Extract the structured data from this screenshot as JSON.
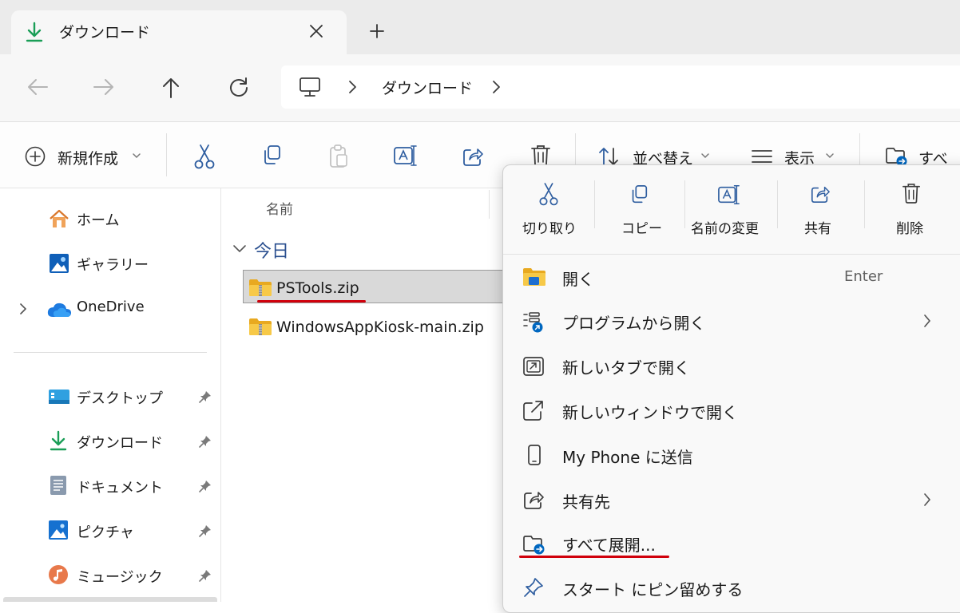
{
  "tab": {
    "title": "ダウンロード",
    "close": "×",
    "new_tab": "+"
  },
  "breadcrumb": {
    "current": "ダウンロード",
    "separator": ">"
  },
  "commandbar": {
    "new": "新規作成",
    "sort": "並べ替え",
    "view": "表示",
    "extract_all": "すべて"
  },
  "navpane": {
    "items": [
      "ホーム",
      "ギャラリー",
      "OneDrive"
    ],
    "pinned": [
      "デスクトップ",
      "ダウンロード",
      "ドキュメント",
      "ピクチャ",
      "ミュージック"
    ]
  },
  "filelist": {
    "column_name": "名前",
    "group": "今日",
    "files": [
      "PSTools.zip",
      "WindowsAppKiosk-main.zip"
    ]
  },
  "context_menu": {
    "quick_actions": [
      "切り取り",
      "コピー",
      "名前の変更",
      "共有",
      "削除"
    ],
    "items": {
      "open": "開く",
      "open_shortcut": "Enter",
      "open_with": "プログラムから開く",
      "open_new_tab": "新しいタブで開く",
      "open_new_window": "新しいウィンドウで開く",
      "send_phone": "My Phone に送信",
      "share_to": "共有先",
      "extract_all": "すべて展開...",
      "pin_start": "スタート にピン留めする"
    }
  },
  "colors": {
    "accent": "#0067c0",
    "download_green": "#1a9e57",
    "highlight_red": "#d0000b",
    "folder_yellow": "#f7c948"
  }
}
